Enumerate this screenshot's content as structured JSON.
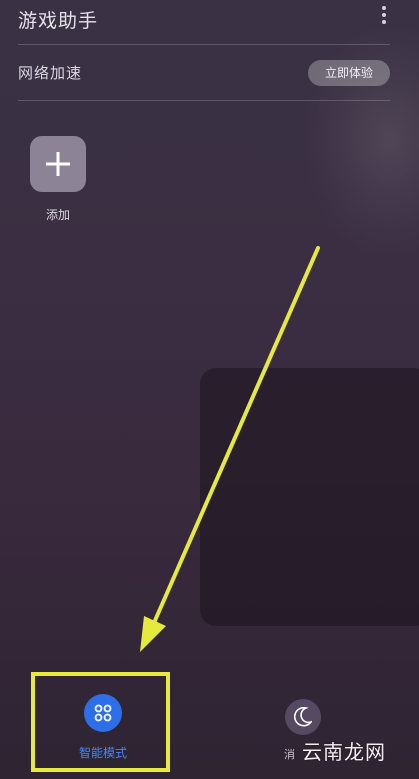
{
  "header": {
    "title": "游戏助手",
    "more_icon": "more-vertical-icon"
  },
  "acceleration": {
    "label": "网络加速",
    "button_label": "立即体验"
  },
  "add_tile": {
    "icon": "plus-icon",
    "label": "添加"
  },
  "bottom_nav": [
    {
      "label": "智能模式",
      "icon": "smart-mode-icon",
      "selected": true,
      "color": "#2d6fe8"
    },
    {
      "label": "消",
      "icon": "moon-icon",
      "selected": false
    }
  ],
  "annotation": {
    "highlight_color": "#e6ea3a"
  },
  "watermark": "云南龙网"
}
